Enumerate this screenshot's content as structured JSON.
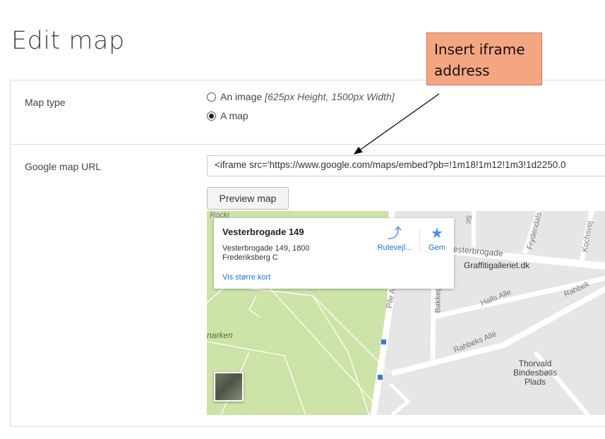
{
  "page": {
    "title": "Edit map"
  },
  "map_type": {
    "label": "Map type",
    "options": [
      {
        "label": "An image",
        "hint": "[625px Height, 1500px Width]",
        "checked": false
      },
      {
        "label": "A map",
        "checked": true
      }
    ]
  },
  "google_map_url": {
    "label": "Google map URL",
    "value": "<iframe  src='https://www.google.com/maps/embed?pb=!1m18!1m12!1m3!1d2250.0"
  },
  "preview_button": {
    "label": "Preview map"
  },
  "map_preview": {
    "place_name": "Vesterbrogade 149",
    "address_line1": "Vesterbrogade 149, 1800",
    "address_line2": "Frederiksberg C",
    "directions_label": "Rutevejl...",
    "save_label": "Gem",
    "larger_map_link": "Vis større kort",
    "accent_color": "#1a73e8",
    "map_labels": {
      "street_vesterbrogade": "esterbrogade",
      "gallery": "Graffitigalleriet.dk",
      "frydendals": "Frydendals",
      "kochsvej": "Kochsvej",
      "sc": "Sc",
      "halls_alle": "Halls Alle",
      "rahbeks_alle": "Rahbeks Allé",
      "rahbek_right": "Rahbek",
      "bakkeg": "Bakkeg",
      "pile": "Pile A",
      "park": "narken",
      "top_left": "Rocki",
      "poi_line1": "Thorvald",
      "poi_line2": "Bindesbølls",
      "poi_line3": "Plads"
    }
  },
  "callout": {
    "line1": "Insert iframe",
    "line2": "address"
  }
}
